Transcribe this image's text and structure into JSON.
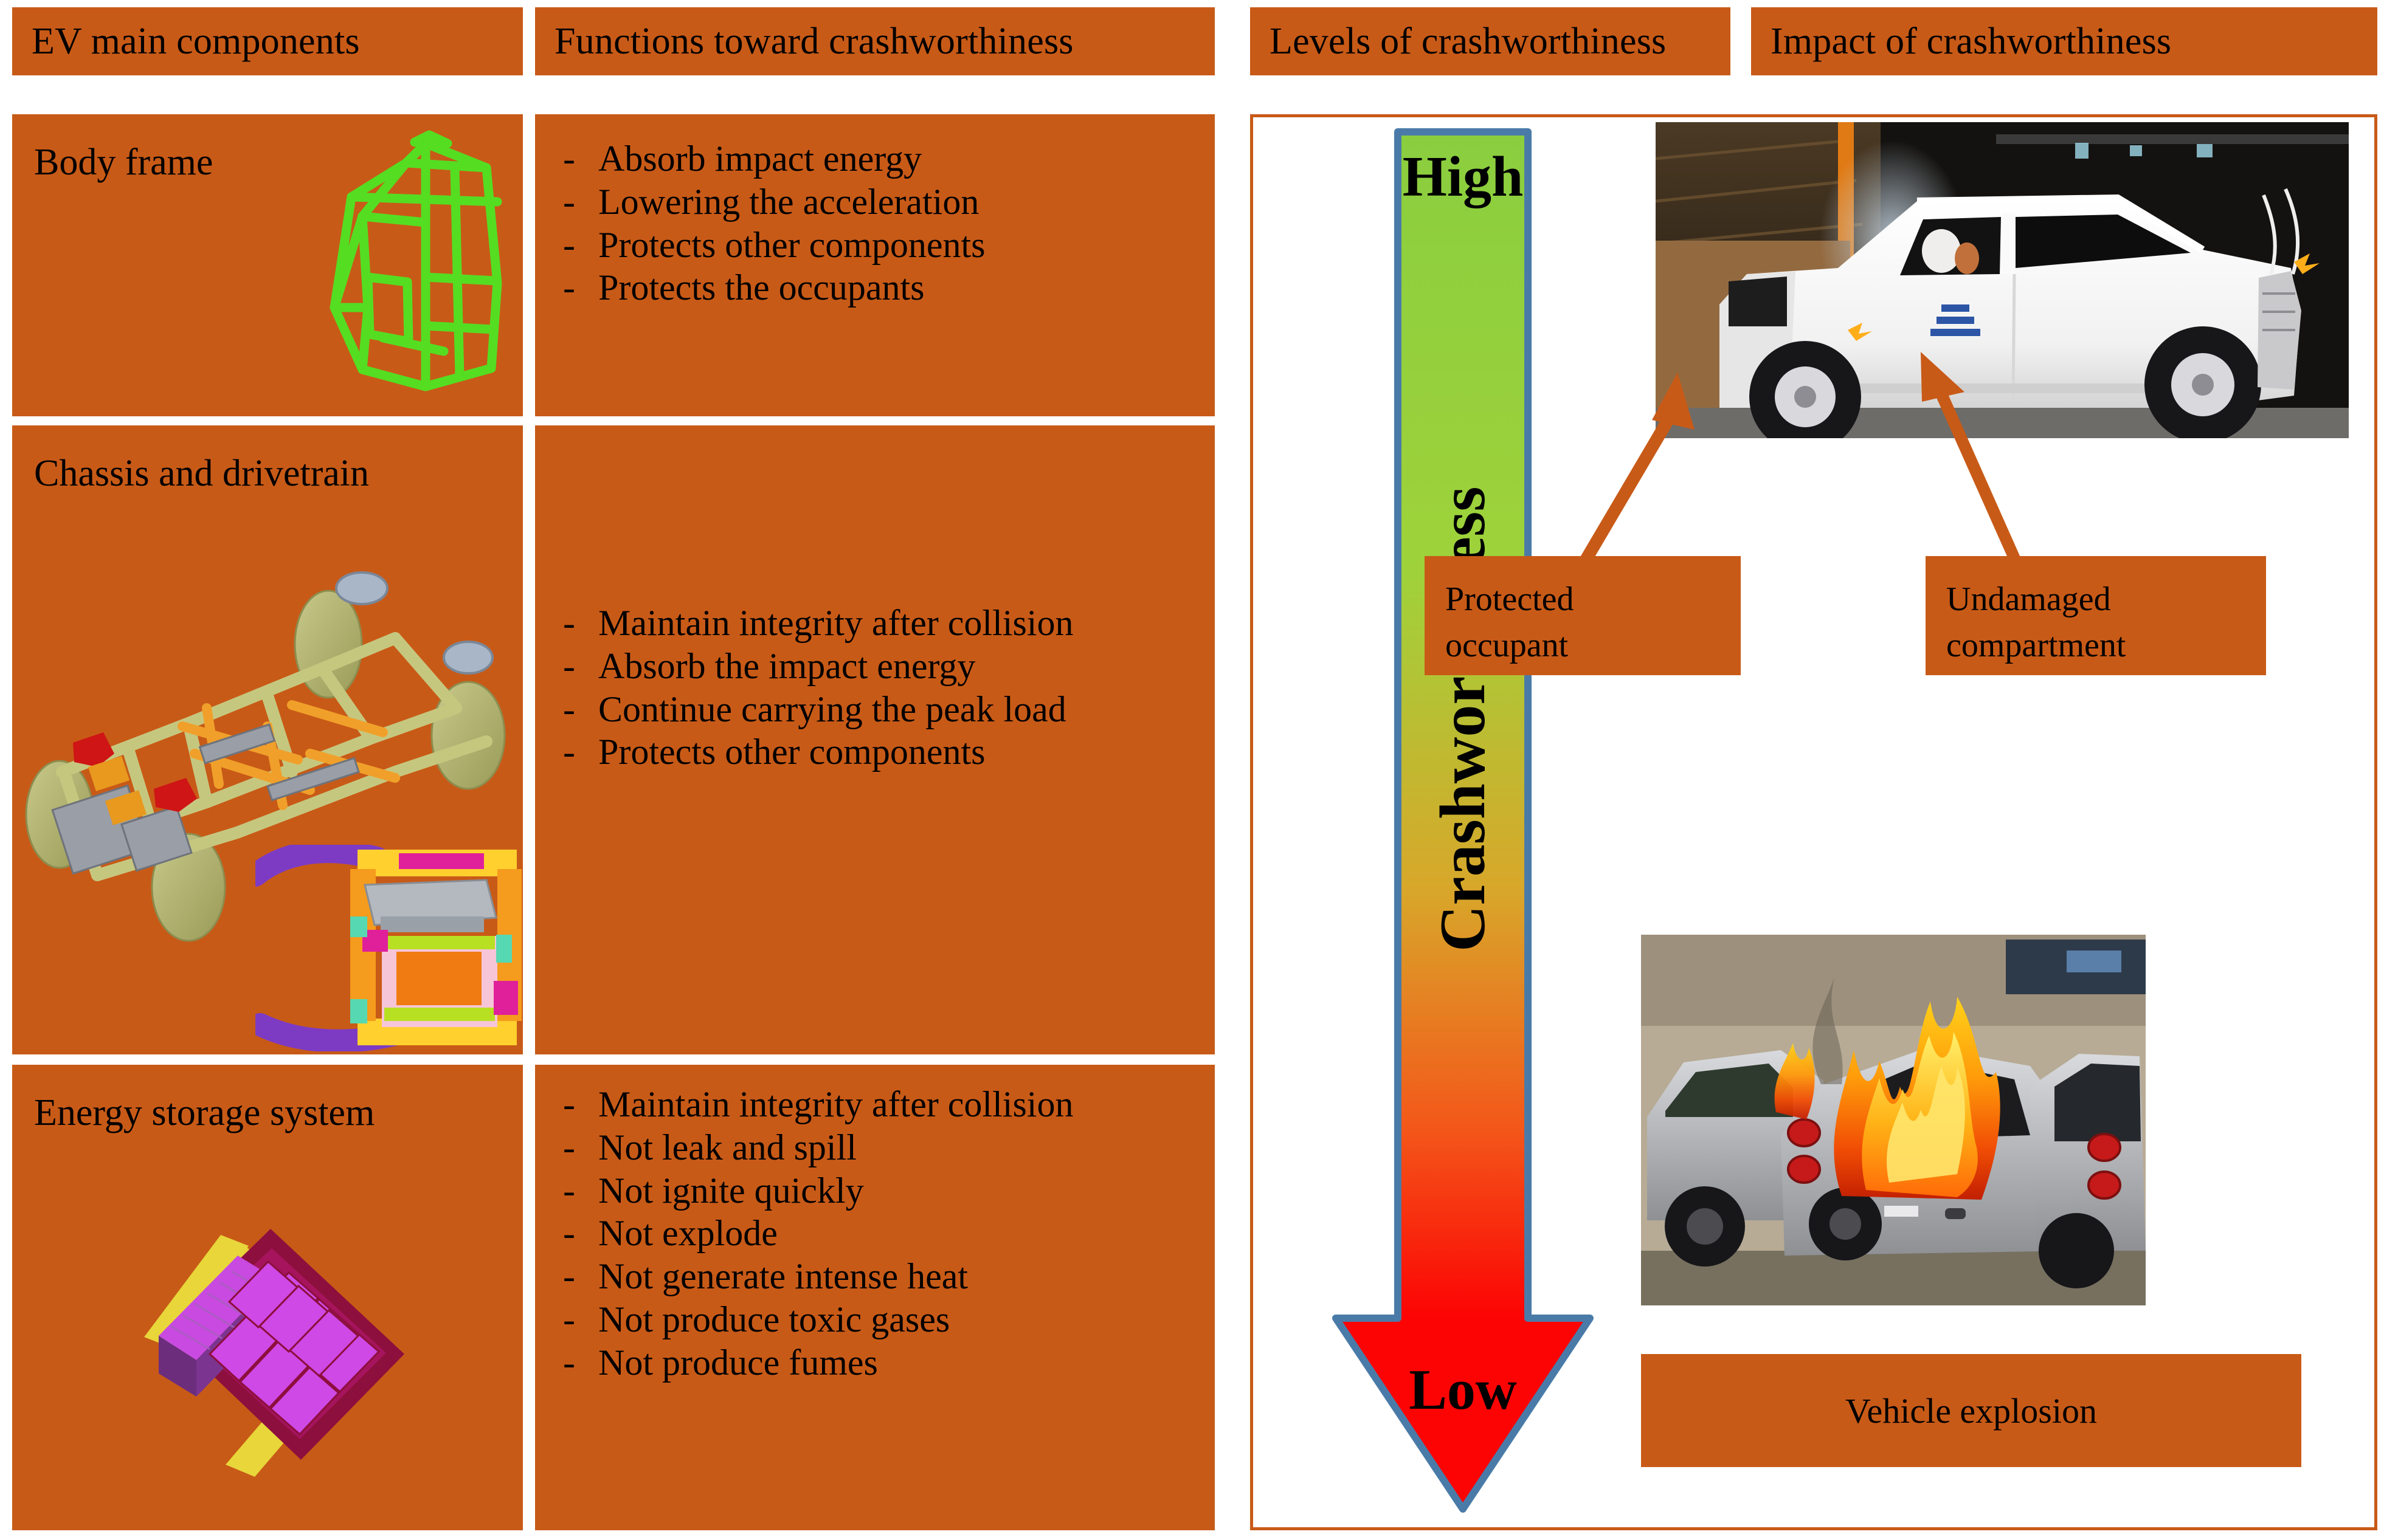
{
  "headers": [
    {
      "label": "EV main  components"
    },
    {
      "label": "Functions toward crashworthiness"
    },
    {
      "label": "Levels of crashworthiness"
    },
    {
      "label": "Impact of crashworthiness"
    }
  ],
  "rows": [
    {
      "component": "Body frame",
      "component_image": "body-frame-wireframe-green",
      "functions": [
        "Absorb impact energy",
        "Lowering the acceleration",
        "Protects other components",
        "Protects the occupants"
      ]
    },
    {
      "component": "Chassis and drivetrain",
      "component_image": "chassis-drivetrain-cad",
      "functions": [
        "Maintain integrity after collision",
        "Absorb the impact energy",
        "Continue carrying the peak load",
        "Protects other components"
      ]
    },
    {
      "component": "Energy storage system",
      "component_image": "battery-pack-cad",
      "functions": [
        "Maintain integrity after collision",
        "Not leak and spill",
        "Not ignite quickly",
        "Not explode",
        "Not generate intense heat",
        "Not produce toxic gases",
        "Not produce fumes"
      ]
    }
  ],
  "levels": {
    "top_label": "High",
    "axis_label": "Crashworthiness",
    "bottom_label": "Low",
    "gradient_top_color": "#8ace3f",
    "gradient_bottom_color": "#fc0404",
    "border_color": "#4a7ba8"
  },
  "impact": {
    "crash_photo_alt": "frontal-crash-test-white-car",
    "fire_photo_alt": "burning-electric-car",
    "callouts": [
      {
        "line1": "Protected",
        "line2": "occupant"
      },
      {
        "line1": "Undamaged",
        "line2": "compartment"
      }
    ],
    "explosion_label": "Vehicle explosion",
    "pointer_color": "#c85a17"
  },
  "theme": {
    "panel_color": "#c85a17",
    "text_color": "#000000",
    "background": "#ffffff"
  },
  "bullet": "-"
}
